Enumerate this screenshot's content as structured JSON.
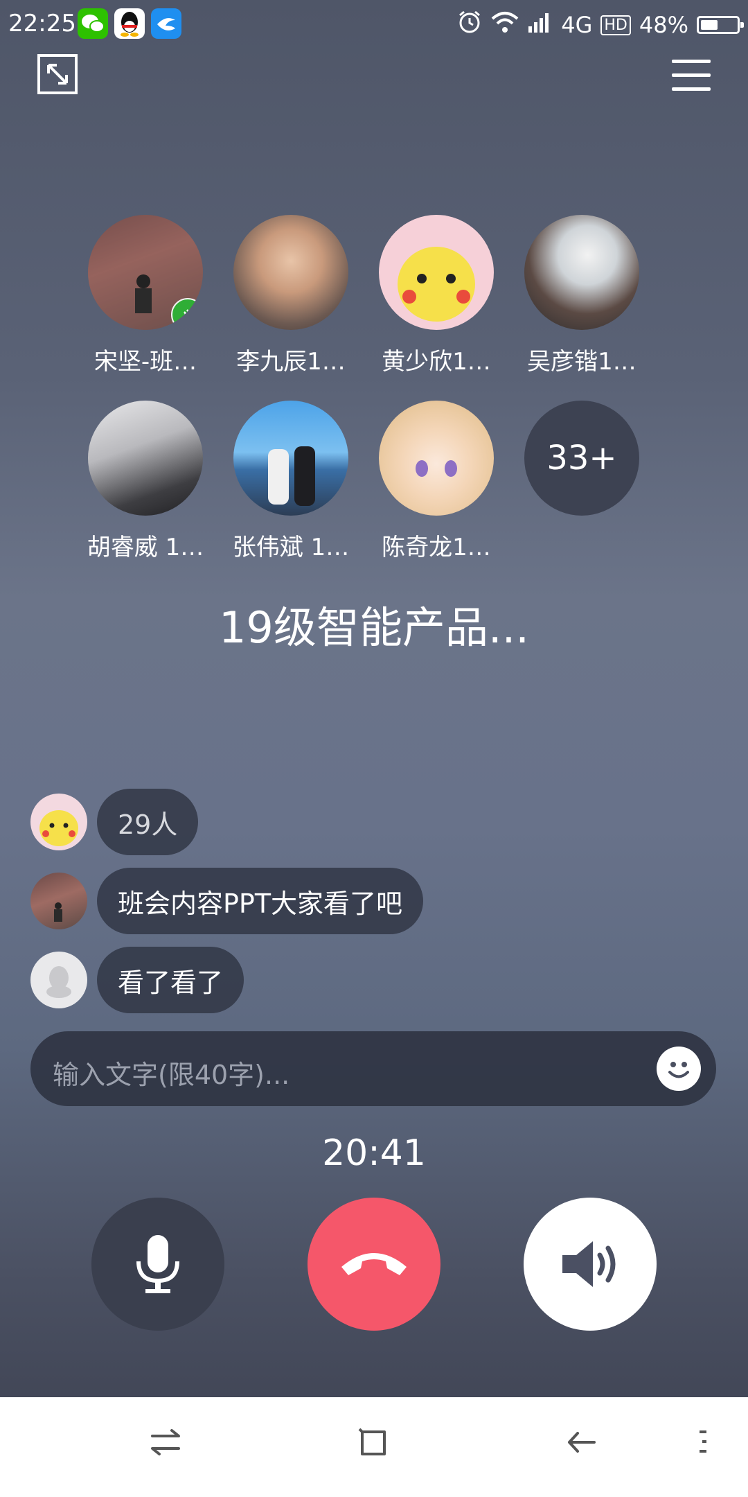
{
  "status_bar": {
    "time": "22:25",
    "apps": [
      "wechat-icon",
      "qq-icon",
      "tim-icon"
    ],
    "network": "4G",
    "hd": "HD",
    "battery": "48%",
    "battery_level": 0.48
  },
  "participants": [
    {
      "name": "宋坚-班…",
      "speaking": true
    },
    {
      "name": "李九辰1…"
    },
    {
      "name": "黄少欣1…"
    },
    {
      "name": "吴彦锴1…"
    },
    {
      "name": "胡睿威 1…"
    },
    {
      "name": "张伟斌 1…"
    },
    {
      "name": "陈奇龙1…"
    }
  ],
  "more_count": "33+",
  "group_title": "19级智能产品...",
  "messages": [
    {
      "text": "29人"
    },
    {
      "text": "班会内容PPT大家看了吧"
    },
    {
      "text": "看了看了"
    }
  ],
  "input": {
    "placeholder": "输入文字(限40字)..."
  },
  "call_timer": "20:41",
  "colors": {
    "hangup": "#f5576a",
    "speaking_badge": "#2fae36"
  }
}
